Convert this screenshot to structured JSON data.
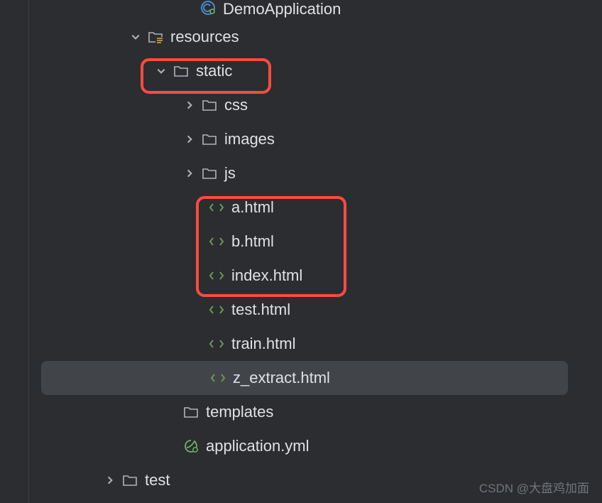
{
  "tree": {
    "class_file": "DemoApplication",
    "resources": "resources",
    "static": "static",
    "css": "css",
    "images": "images",
    "js": "js",
    "a_html": "a.html",
    "b_html": "b.html",
    "index_html": "index.html",
    "test_html": "test.html",
    "train_html": "train.html",
    "z_extract_html": "z_extract.html",
    "templates": "templates",
    "application_yml": "application.yml",
    "test": "test"
  },
  "watermark": "CSDN @大盘鸡加面"
}
